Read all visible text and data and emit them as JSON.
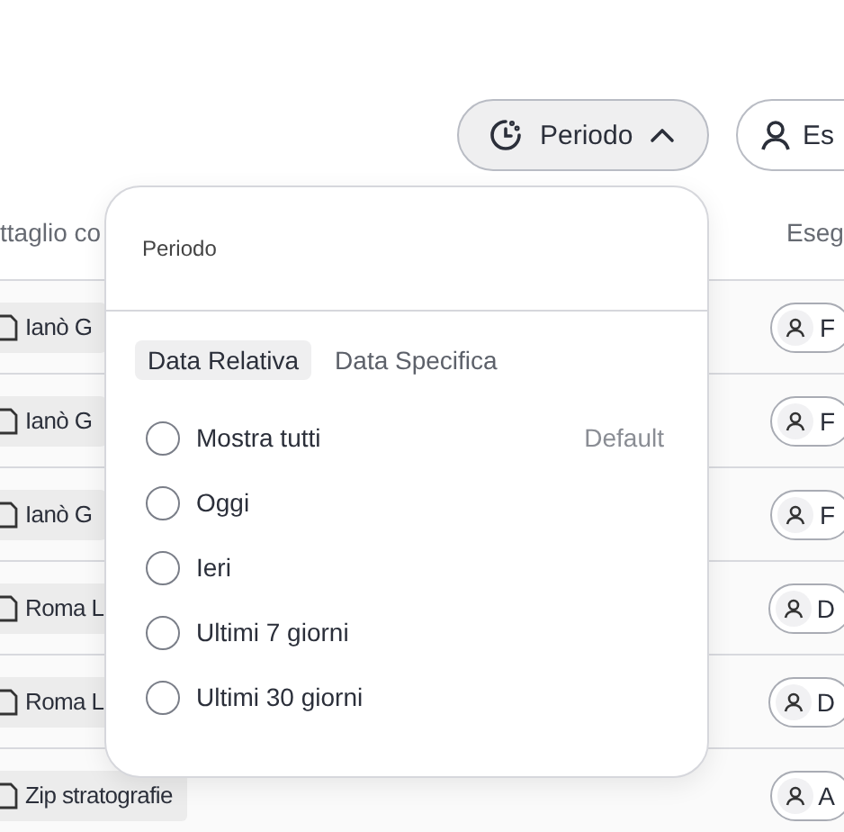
{
  "toolbar": {
    "buttons": [
      {
        "kind": "period",
        "label": "Periodo",
        "expanded": true
      },
      {
        "kind": "user",
        "label": "Es"
      }
    ]
  },
  "table": {
    "columns": [
      "ttaglio co",
      "Eseg"
    ],
    "rows": [
      {
        "document": "Ianò G",
        "executor": "F"
      },
      {
        "document": "Ianò G",
        "executor": "F"
      },
      {
        "document": "Ianò G",
        "executor": "F"
      },
      {
        "document": "Roma L",
        "executor": "D"
      },
      {
        "document": "Roma L",
        "executor": "D"
      },
      {
        "document": "Zip stratografie",
        "executor": "A"
      }
    ]
  },
  "popover": {
    "title": "Periodo",
    "tabs": [
      {
        "label": "Data Relativa",
        "selected": true
      },
      {
        "label": "Data Specifica",
        "selected": false
      }
    ],
    "options": [
      {
        "label": "Mostra tutti",
        "selected": false,
        "note": "Default"
      },
      {
        "label": "Oggi",
        "selected": false
      },
      {
        "label": "Ieri",
        "selected": false
      },
      {
        "label": "Ultimi 7 giorni",
        "selected": false
      },
      {
        "label": "Ultimi 30 giorni",
        "selected": false
      }
    ]
  }
}
